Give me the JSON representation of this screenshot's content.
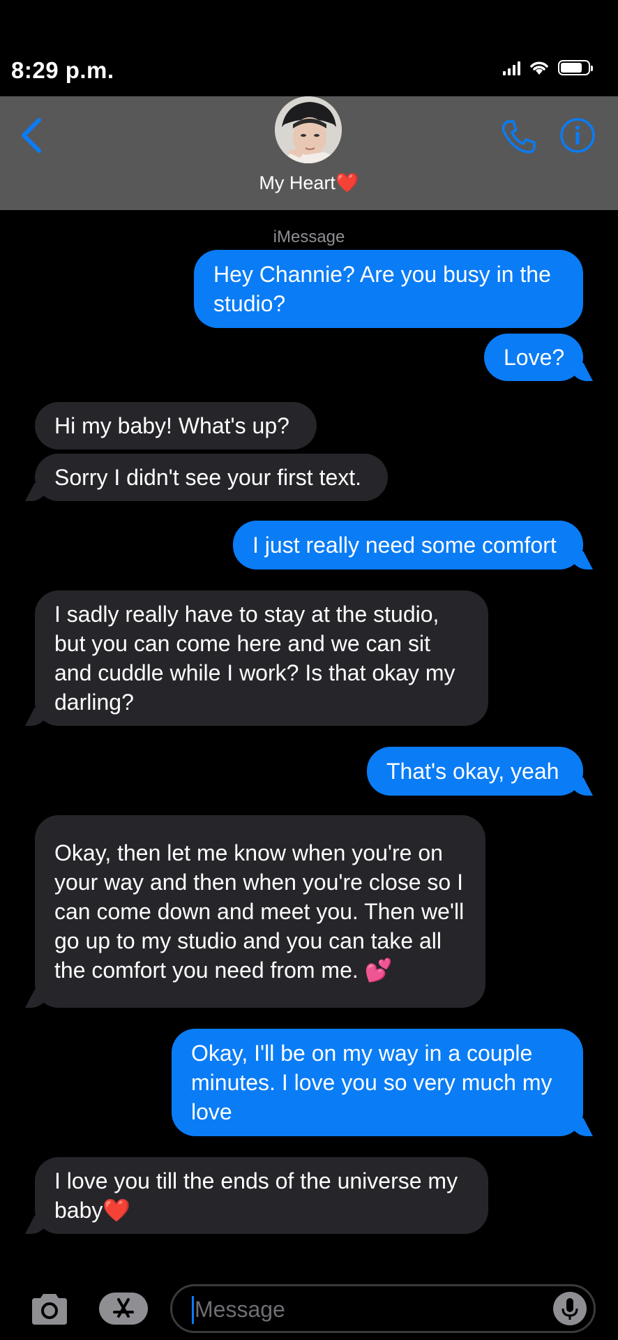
{
  "status_bar": {
    "time": "8:29 p.m.",
    "battery_level": 0.8
  },
  "header": {
    "contact_name": "My Heart❤️",
    "avatar": "contact-avatar-photo"
  },
  "service_label": "iMessage",
  "messages": [
    {
      "sender": "me",
      "text": "Hey Channie? Are you busy in the studio?"
    },
    {
      "sender": "me",
      "text": "Love?"
    },
    {
      "sender": "contact",
      "text": "Hi my baby! What's up?"
    },
    {
      "sender": "contact",
      "text": "Sorry I didn't see your first text."
    },
    {
      "sender": "me",
      "text": "I just really need some comfort"
    },
    {
      "sender": "contact",
      "text": "I sadly really have to stay at the studio, but you can come here and we can sit and cuddle while I work? Is that okay my darling?"
    },
    {
      "sender": "me",
      "text": "That's okay, yeah"
    },
    {
      "sender": "contact",
      "text": "Okay, then let me know when you're on your way and then when you're close so I can come down and meet you. Then we'll go up to my studio and you can take all the comfort you need from me. 💕"
    },
    {
      "sender": "me",
      "text": "Okay, I'll be on my way in a couple minutes. I love you so very much my love"
    },
    {
      "sender": "contact",
      "text": "I love you till the ends of the universe my baby❤️"
    }
  ],
  "composer": {
    "placeholder": "Message"
  },
  "colors": {
    "sent_bubble": "#0a7cf6",
    "received_bubble": "#26252a",
    "accent": "#0a7cf6",
    "header": "#585858"
  }
}
